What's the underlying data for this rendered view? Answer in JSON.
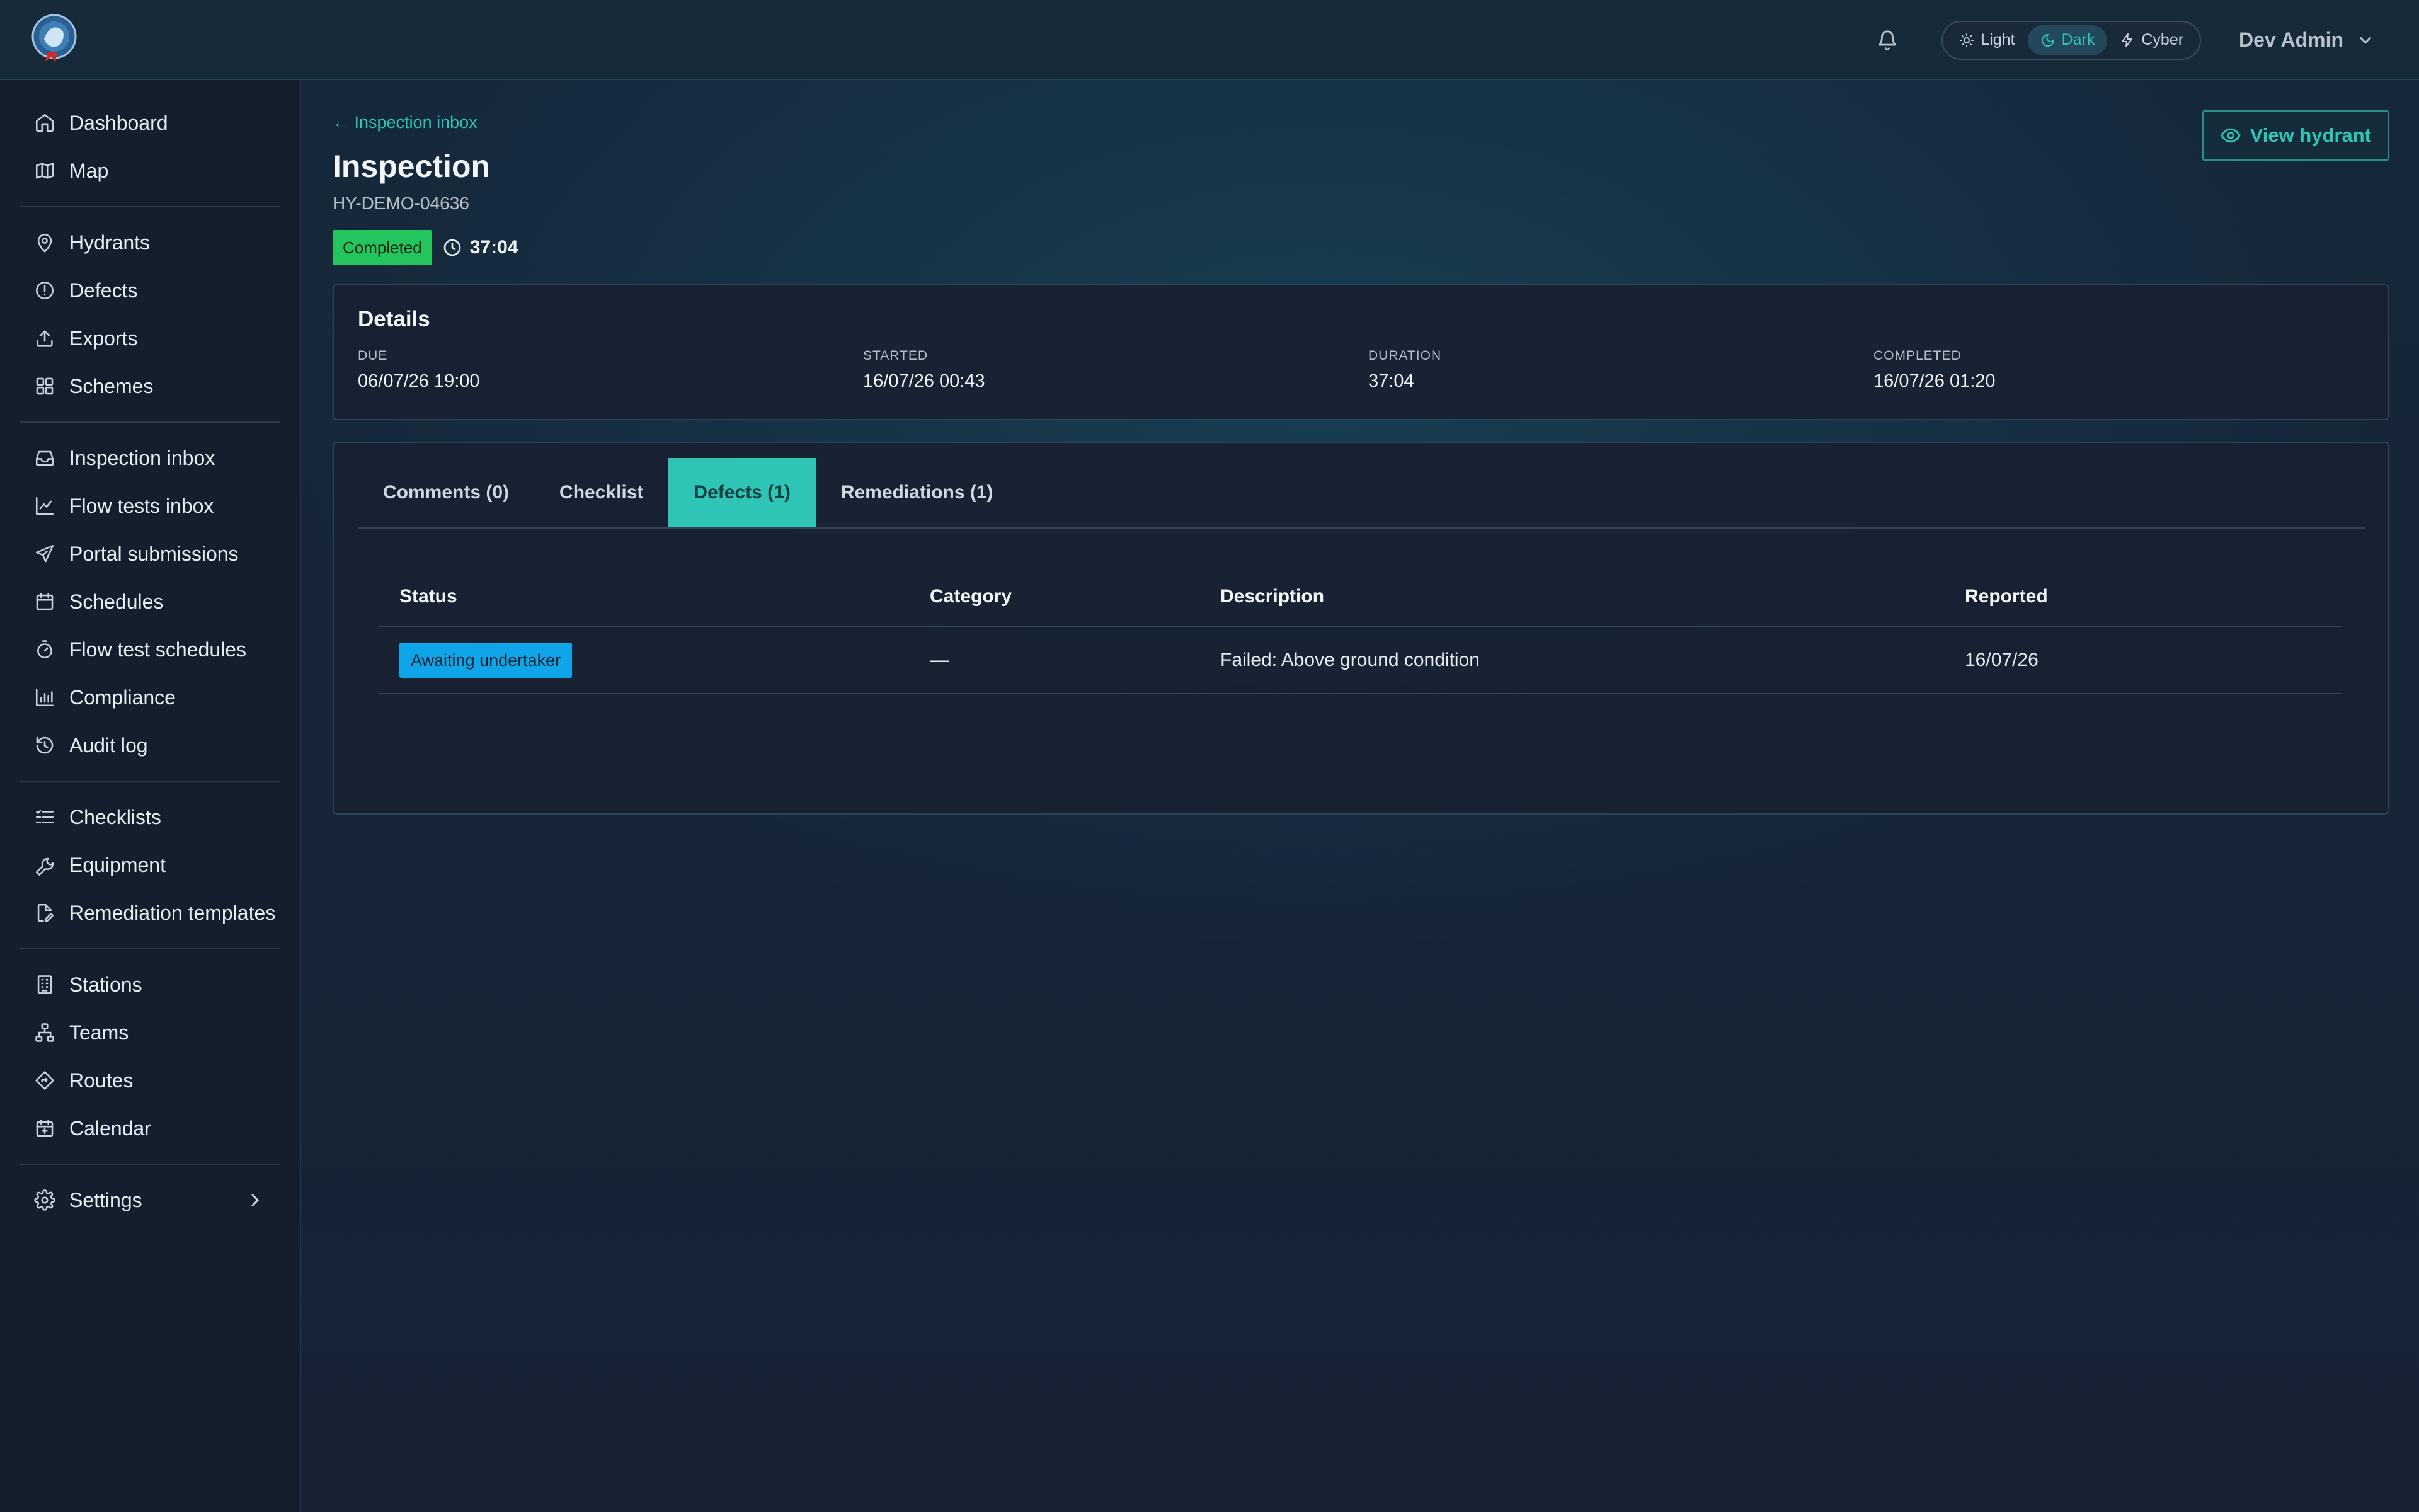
{
  "theme": {
    "options": [
      {
        "label": "Light",
        "icon": "sun-icon"
      },
      {
        "label": "Dark",
        "icon": "moon-icon",
        "active": true
      },
      {
        "label": "Cyber",
        "icon": "bolt-icon"
      }
    ]
  },
  "user": {
    "name": "Dev Admin"
  },
  "sidebar": {
    "groups": [
      [
        {
          "label": "Dashboard",
          "icon": "home-icon"
        },
        {
          "label": "Map",
          "icon": "map-icon"
        }
      ],
      [
        {
          "label": "Hydrants",
          "icon": "map-pin-icon"
        },
        {
          "label": "Defects",
          "icon": "alert-circle-icon"
        },
        {
          "label": "Exports",
          "icon": "upload-icon"
        },
        {
          "label": "Schemes",
          "icon": "grid-icon"
        }
      ],
      [
        {
          "label": "Inspection inbox",
          "icon": "inbox-icon"
        },
        {
          "label": "Flow tests inbox",
          "icon": "line-chart-icon"
        },
        {
          "label": "Portal submissions",
          "icon": "send-icon"
        },
        {
          "label": "Schedules",
          "icon": "calendar-icon"
        },
        {
          "label": "Flow test schedules",
          "icon": "timer-icon"
        },
        {
          "label": "Compliance",
          "icon": "bar-chart-icon"
        },
        {
          "label": "Audit log",
          "icon": "history-icon"
        }
      ],
      [
        {
          "label": "Checklists",
          "icon": "list-checks-icon"
        },
        {
          "label": "Equipment",
          "icon": "wrench-icon"
        },
        {
          "label": "Remediation templates",
          "icon": "file-edit-icon"
        }
      ],
      [
        {
          "label": "Stations",
          "icon": "building-icon"
        },
        {
          "label": "Teams",
          "icon": "network-icon"
        },
        {
          "label": "Routes",
          "icon": "route-icon"
        },
        {
          "label": "Calendar",
          "icon": "calendar-plus-icon"
        }
      ]
    ],
    "settings": {
      "label": "Settings",
      "icon": "gear-icon"
    }
  },
  "page": {
    "back_link": "← Inspection inbox",
    "title": "Inspection",
    "subtitle": "HY-DEMO-04636",
    "status": "Completed",
    "timer": "37:04",
    "view_button": "View hydrant"
  },
  "details": {
    "heading": "Details",
    "fields": [
      {
        "label": "DUE",
        "value": "06/07/26 19:00"
      },
      {
        "label": "STARTED",
        "value": "16/07/26 00:43"
      },
      {
        "label": "DURATION",
        "value": "37:04"
      },
      {
        "label": "COMPLETED",
        "value": "16/07/26 01:20"
      }
    ]
  },
  "tabs": [
    {
      "label": "Comments (0)"
    },
    {
      "label": "Checklist"
    },
    {
      "label": "Defects (1)",
      "active": true
    },
    {
      "label": "Remediations (1)"
    }
  ],
  "defects_table": {
    "columns": [
      "Status",
      "Category",
      "Description",
      "Reported"
    ],
    "rows": [
      {
        "status": "Awaiting undertaker",
        "category": "—",
        "description": "Failed: Above ground condition",
        "reported": "16/07/26"
      }
    ]
  },
  "colors": {
    "accent": "#2ec4b6",
    "completed": "#22c55e",
    "awaiting": "#0ea5e9"
  }
}
